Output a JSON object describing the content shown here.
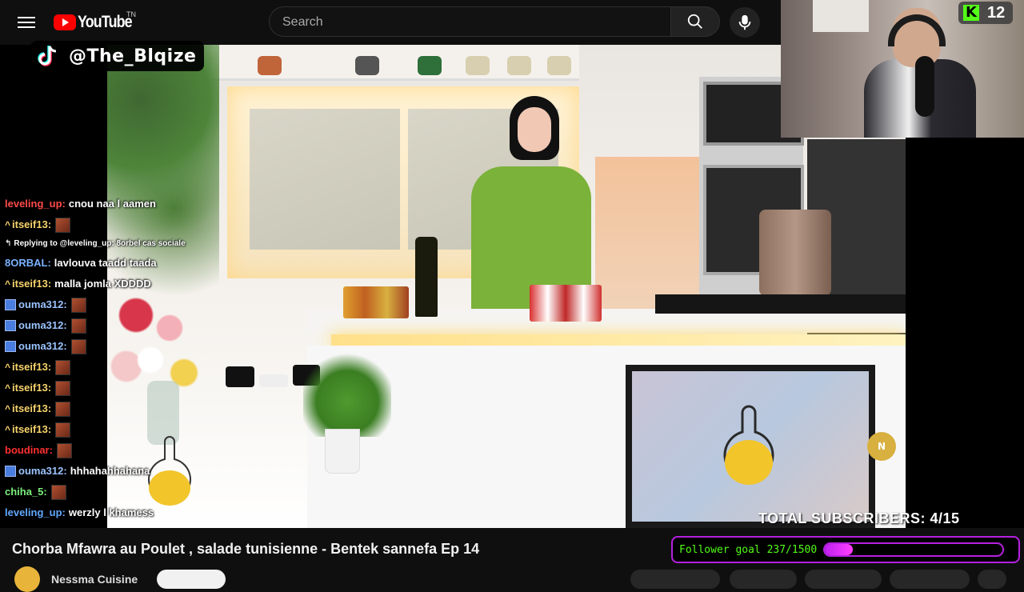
{
  "youtube": {
    "logo_text": "YouTube",
    "tm": "TN",
    "search_placeholder": "Search"
  },
  "tiktok": {
    "handle": "@The_Blqize"
  },
  "kick": {
    "viewer_count": "12"
  },
  "chat": {
    "messages": [
      {
        "user": "leveling_up:",
        "color": "#ff4a4a",
        "badge": "none",
        "text": "cnou naa l aamen",
        "emote": false
      },
      {
        "user": "itseif13:",
        "color": "#f6d36b",
        "badge": "crown",
        "text": "",
        "emote": true
      },
      {
        "user": "",
        "color": "#ddd",
        "badge": "reply",
        "text": "Replying to @leveling_up: 8orbel cas sociale",
        "emote": false
      },
      {
        "user": "8ORBAL:",
        "color": "#7ab2ff",
        "badge": "none",
        "text": "lavlouva taadd taada",
        "emote": false
      },
      {
        "user": "itseif13:",
        "color": "#f6d36b",
        "badge": "crown",
        "text": "malla jomla XDDDD",
        "emote": false
      },
      {
        "user": "ouma312:",
        "color": "#9bc4ff",
        "badge": "box",
        "text": "",
        "emote": true
      },
      {
        "user": "ouma312:",
        "color": "#9bc4ff",
        "badge": "box",
        "text": "",
        "emote": true
      },
      {
        "user": "ouma312:",
        "color": "#9bc4ff",
        "badge": "box",
        "text": "",
        "emote": true
      },
      {
        "user": "itseif13:",
        "color": "#f6d36b",
        "badge": "crown",
        "text": "",
        "emote": true
      },
      {
        "user": "itseif13:",
        "color": "#f6d36b",
        "badge": "crown",
        "text": "",
        "emote": true
      },
      {
        "user": "itseif13:",
        "color": "#f6d36b",
        "badge": "crown",
        "text": "",
        "emote": true
      },
      {
        "user": "itseif13:",
        "color": "#f6d36b",
        "badge": "crown",
        "text": "",
        "emote": true
      },
      {
        "user": "boudinar:",
        "color": "#ff3030",
        "badge": "none",
        "text": "",
        "emote": true
      },
      {
        "user": "ouma312:",
        "color": "#9bc4ff",
        "badge": "box",
        "text": "hhhahahhahana",
        "emote": false
      },
      {
        "user": "chiha_5:",
        "color": "#7cf07c",
        "badge": "none",
        "text": "",
        "emote": true
      },
      {
        "user": "leveling_up:",
        "color": "#62a8ff",
        "badge": "none",
        "text": "werzly l khamess",
        "emote": false
      }
    ]
  },
  "overlay": {
    "subscribers": "TOTAL SUBSCRIBERS: 4/15",
    "follower_goal_text": "Follower goal 237/1500",
    "follower_goal_current": 237,
    "follower_goal_target": 1500
  },
  "video": {
    "title": "Chorba Mfawra au Poulet , salade tunisienne - Bentek sannefa Ep 14",
    "channel": "Nessma Cuisine"
  },
  "colors": {
    "accent_purple": "#b620e0",
    "kick_green": "#53fc18",
    "youtube_red": "#ff0000"
  }
}
